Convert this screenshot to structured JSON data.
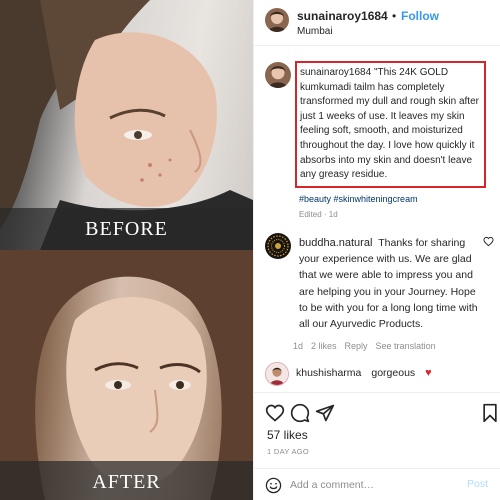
{
  "photos": {
    "before_label": "BEFORE",
    "after_label": "AFTER"
  },
  "header": {
    "username": "sunainaroy1684",
    "separator": "•",
    "follow_label": "Follow",
    "location": "Mumbai"
  },
  "caption": {
    "username": "sunainaroy1684",
    "text": "\"This 24K GOLD kumkumadi tailm  has completely transformed my dull and rough skin after just 1 weeks of use. It leaves my skin feeling soft, smooth, and moisturized throughout the day. I love how quickly it absorbs into my skin and doesn't leave any greasy residue.",
    "hashtags": "#beauty #skinwhiteningcream",
    "edited": "Edited · 1d",
    "highlight_color": "#d7262b"
  },
  "comment": {
    "username": "buddha.natural",
    "text": "Thanks for sharing your experience with us. We are glad that we were able to impress you and are helping you in your Journey. Hope to be with you for a long long time with all our Ayurvedic Products.",
    "meta": {
      "time": "1d",
      "likes": "2 likes",
      "reply": "Reply",
      "translation": "See translation"
    }
  },
  "reply": {
    "username": "khushisharma",
    "text": "gorgeous",
    "emoji": "♥"
  },
  "actions": {
    "likes": "57 likes",
    "time_ago": "1 DAY AGO"
  },
  "comment_bar": {
    "placeholder": "Add a comment…",
    "post_label": "Post"
  },
  "colors": {
    "link_blue": "#3897f0",
    "post_disabled": "#b3dbff",
    "muted": "#8e8e8e",
    "heart_red": "#e0262b"
  },
  "icons": [
    "heart-icon",
    "comment-icon",
    "share-icon",
    "bookmark-icon",
    "emoji-icon",
    "small-heart-icon"
  ]
}
